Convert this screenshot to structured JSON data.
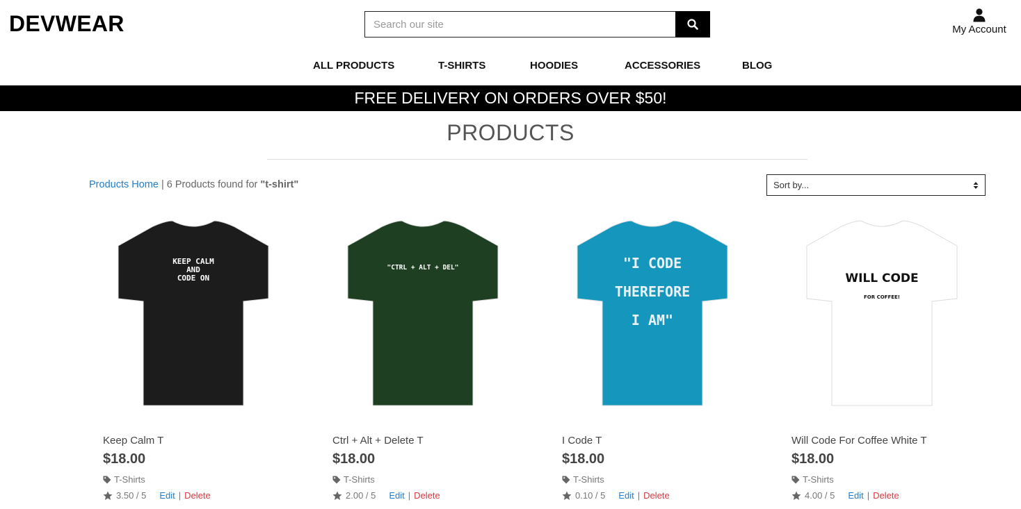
{
  "header": {
    "logo": "DEVWEAR",
    "search_placeholder": "Search our site",
    "account_label": "My Account"
  },
  "nav": [
    "ALL PRODUCTS",
    "T-SHIRTS",
    "HOODIES",
    "ACCESSORIES",
    "BLOG"
  ],
  "banner": "FREE DELIVERY ON ORDERS OVER $50!",
  "page_title": "PRODUCTS",
  "results": {
    "home_link": "Products Home",
    "separator": "|",
    "found_text": "6 Products found for",
    "query": "\"t-shirt\""
  },
  "sort": {
    "selected": "Sort by..."
  },
  "products": [
    {
      "name": "Keep Calm T",
      "price": "$18.00",
      "category": "T-Shirts",
      "rating": "3.50 / 5",
      "edit": "Edit",
      "delete": "Delete",
      "shirt_color": "#1c1c1c",
      "print_lines": [
        "KEEP CALM",
        "AND",
        "CODE ON"
      ],
      "print_color": "#ffffff"
    },
    {
      "name": "Ctrl + Alt + Delete T",
      "price": "$18.00",
      "category": "T-Shirts",
      "rating": "2.00 / 5",
      "edit": "Edit",
      "delete": "Delete",
      "shirt_color": "#1f3f22",
      "print_lines": [
        "\"CTRL + ALT + DEL\""
      ],
      "print_color": "#ffffff"
    },
    {
      "name": "I Code T",
      "price": "$18.00",
      "category": "T-Shirts",
      "rating": "0.10 / 5",
      "edit": "Edit",
      "delete": "Delete",
      "shirt_color": "#1597bd",
      "print_lines": [
        "\"I CODE",
        "THEREFORE",
        "I AM\""
      ],
      "print_color": "#e9f1f4"
    },
    {
      "name": "Will Code For Coffee White T",
      "price": "$18.00",
      "category": "T-Shirts",
      "rating": "4.00 / 5",
      "edit": "Edit",
      "delete": "Delete",
      "shirt_color": "#ffffff",
      "print_lines": [
        "WILL CODE",
        "FOR COFFEE!"
      ],
      "print_color": "#111111"
    }
  ]
}
